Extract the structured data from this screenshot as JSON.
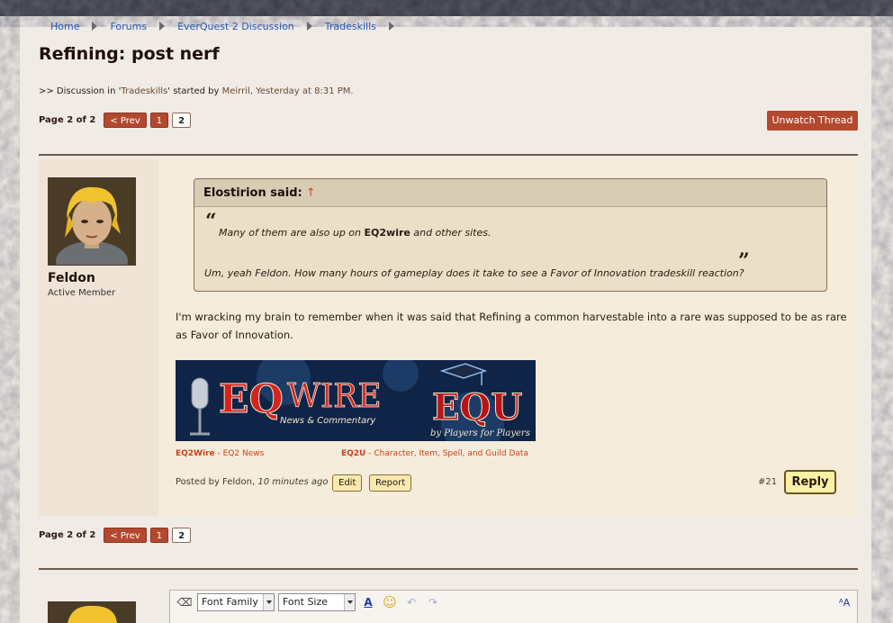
{
  "breadcrumb": [
    "Home",
    "Forums",
    "EverQuest 2 Discussion",
    "Tradeskills"
  ],
  "thread": {
    "title": "Refining: post nerf",
    "meta_prefix": ">> Discussion in '",
    "meta_forum": "Tradeskills",
    "meta_mid": "' started by ",
    "meta_author": "Meirril",
    "meta_suffix": ", Yesterday at 8:31 PM."
  },
  "pagination": {
    "label": "Page 2 of 2",
    "prev": "< Prev",
    "pages": [
      "1",
      "2"
    ],
    "current": "2"
  },
  "unwatch_label": "Unwatch Thread",
  "post": {
    "author": "Feldon",
    "author_title": "Active Member",
    "quote": {
      "header": "Elostirion said:",
      "arrow": "↑",
      "line1_prefix": "Many of them are also up on ",
      "line1_bold": "EQ2wire",
      "line1_suffix": " and other sites.",
      "line2": "Um, yeah Feldon. How many hours of gameplay does it take to see a Favor of Innovation tradeskill reaction?",
      "open_mark": "“",
      "close_mark": "”"
    },
    "body_line1": "I'm wracking my brain to remember when it was said that Refining a common harvestable into a rare was supposed to be as rare",
    "body_line2": "as Favor of Innovation.",
    "banner": {
      "eq": "EQ",
      "wire": "WIRE",
      "news": "News & Commentary",
      "equ": "EQU",
      "players": "by Players for Players"
    },
    "signature": {
      "left_link": "EQ2Wire",
      "left_sub": " - EQ2 News",
      "right_link": "EQ2U",
      "right_sub": " - Character, Item, Spell, and Guild Data"
    },
    "posted_prefix": "Posted by Feldon, ",
    "posted_time": "10 minutes ago",
    "edit_label": "Edit",
    "report_label": "Report",
    "number": "#21",
    "reply_label": "Reply"
  },
  "editor": {
    "font_family": "Font Family",
    "font_size": "Font Size"
  },
  "colors": {
    "accent": "#b2492e",
    "link": "#2456b8",
    "post_bg": "#f5ecdb",
    "quote_bg": "#ecdfc7"
  }
}
